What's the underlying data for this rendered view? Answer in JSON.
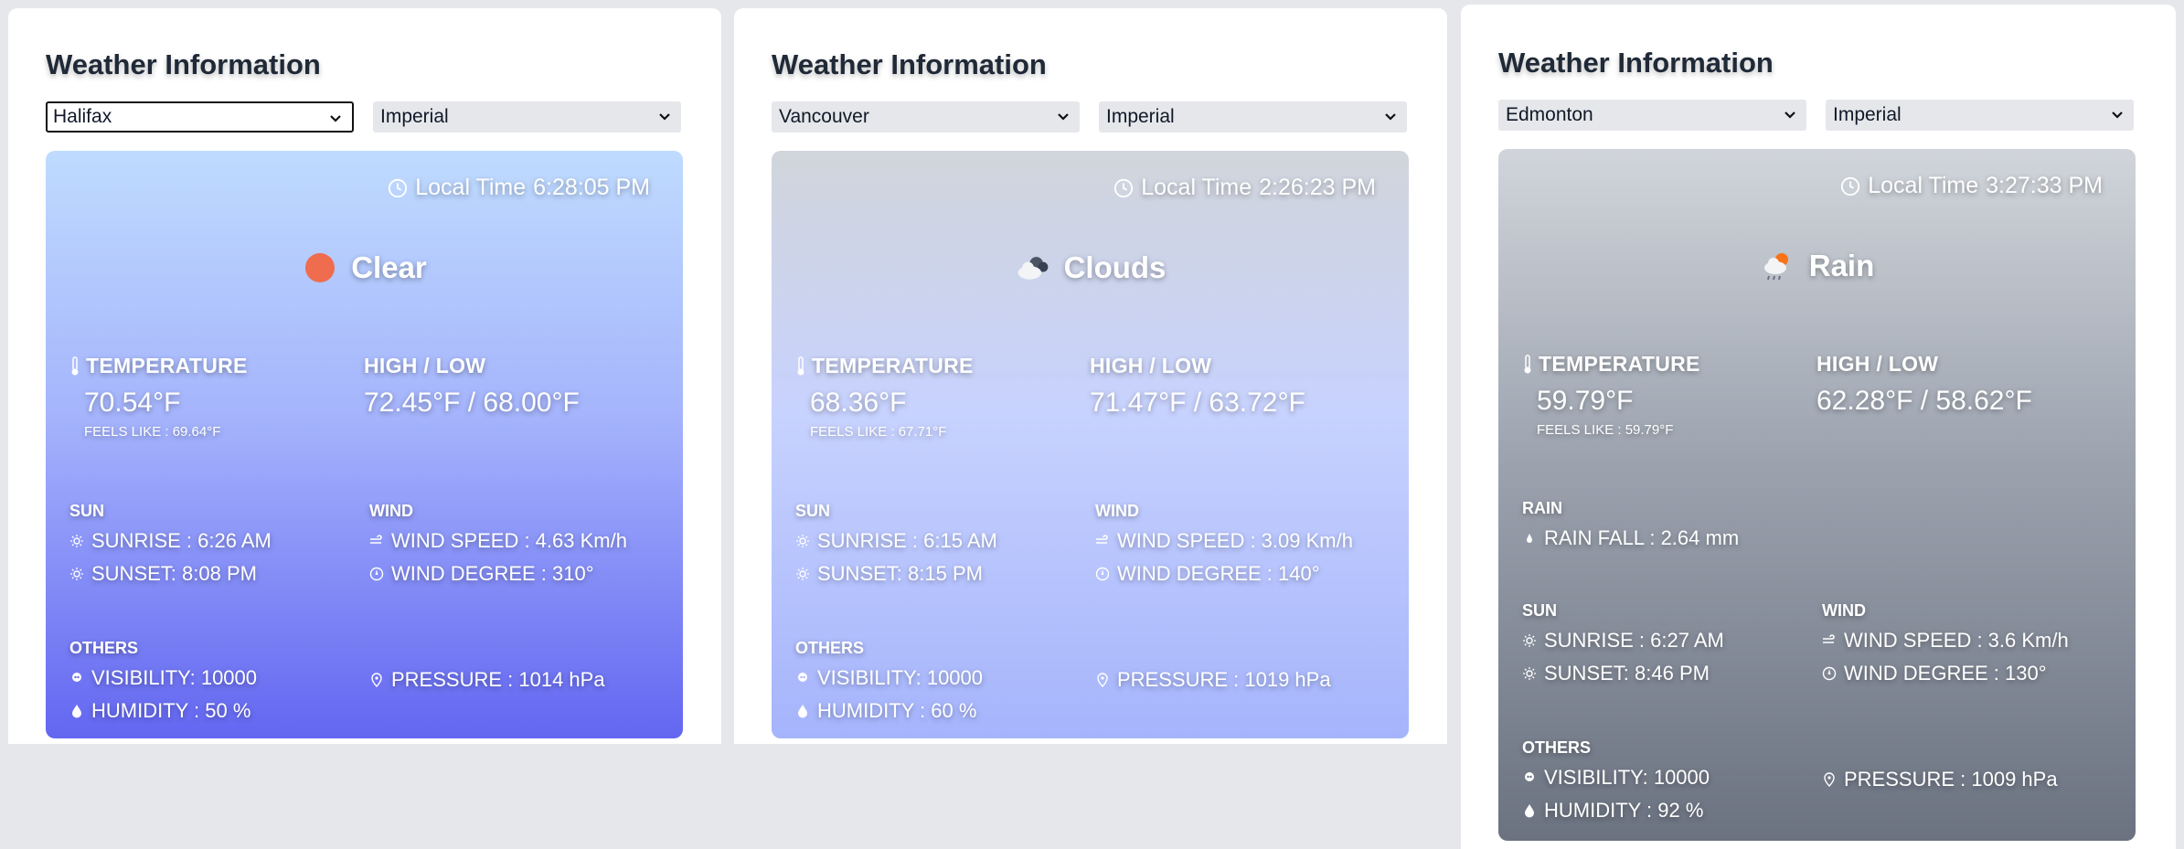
{
  "panels": [
    {
      "title": "Weather Information",
      "city": "Halifax",
      "units": "Imperial",
      "local_time_label": "Local Time",
      "local_time": "6:28:05 PM",
      "condition": "Clear",
      "temperature_label": "TEMPERATURE",
      "temperature": "70.54°F",
      "feels_like": "FEELS LIKE : 69.64°F",
      "highlow_label": "HIGH / LOW",
      "highlow": "72.45°F / 68.00°F",
      "sun_label": "SUN",
      "sunrise": "SUNRISE : 6:26 AM",
      "sunset": "SUNSET: 8:08 PM",
      "wind_label": "WIND",
      "wind_speed": "WIND SPEED : 4.63 Km/h",
      "wind_degree": "WIND DEGREE : 310°",
      "others_label": "OTHERS",
      "visibility": "VISIBILITY: 10000",
      "humidity": "HUMIDITY : 50 %",
      "pressure": "PRESSURE : 1014 hPa"
    },
    {
      "title": "Weather Information",
      "city": "Vancouver",
      "units": "Imperial",
      "local_time_label": "Local Time",
      "local_time": "2:26:23 PM",
      "condition": "Clouds",
      "temperature_label": "TEMPERATURE",
      "temperature": "68.36°F",
      "feels_like": "FEELS LIKE : 67.71°F",
      "highlow_label": "HIGH / LOW",
      "highlow": "71.47°F / 63.72°F",
      "sun_label": "SUN",
      "sunrise": "SUNRISE : 6:15 AM",
      "sunset": "SUNSET: 8:15 PM",
      "wind_label": "WIND",
      "wind_speed": "WIND SPEED : 3.09 Km/h",
      "wind_degree": "WIND DEGREE : 140°",
      "others_label": "OTHERS",
      "visibility": "VISIBILITY: 10000",
      "humidity": "HUMIDITY : 60 %",
      "pressure": "PRESSURE : 1019 hPa"
    },
    {
      "title": "Weather Information",
      "city": "Edmonton",
      "units": "Imperial",
      "local_time_label": "Local Time",
      "local_time": "3:27:33 PM",
      "condition": "Rain",
      "temperature_label": "TEMPERATURE",
      "temperature": "59.79°F",
      "feels_like": "FEELS LIKE : 59.79°F",
      "highlow_label": "HIGH / LOW",
      "highlow": "62.28°F / 58.62°F",
      "rain_label": "RAIN",
      "rain_fall": "RAIN FALL : 2.64 mm",
      "sun_label": "SUN",
      "sunrise": "SUNRISE : 6:27 AM",
      "sunset": "SUNSET: 8:46 PM",
      "wind_label": "WIND",
      "wind_speed": "WIND SPEED : 3.6 Km/h",
      "wind_degree": "WIND DEGREE : 130°",
      "others_label": "OTHERS",
      "visibility": "VISIBILITY: 10000",
      "humidity": "HUMIDITY : 92 %",
      "pressure": "PRESSURE : 1009 hPa"
    }
  ],
  "icons": {
    "clock": "clock-icon",
    "clear": "sun-disc-icon",
    "clouds": "cloud-icon",
    "rain": "rain-cloud-icon",
    "thermometer": "thermometer-icon",
    "sunrise": "sunrise-icon",
    "sunset": "sunset-icon",
    "wind": "wind-icon",
    "compass": "compass-icon",
    "visibility": "eye-icon",
    "humidity": "droplet-icon",
    "pressure": "gauge-icon",
    "rain_drop": "raindrop-icon"
  },
  "colors": {
    "clear_sun": "#ef6c4e",
    "card_text": "#ffffff",
    "title_text": "#1f2937"
  }
}
